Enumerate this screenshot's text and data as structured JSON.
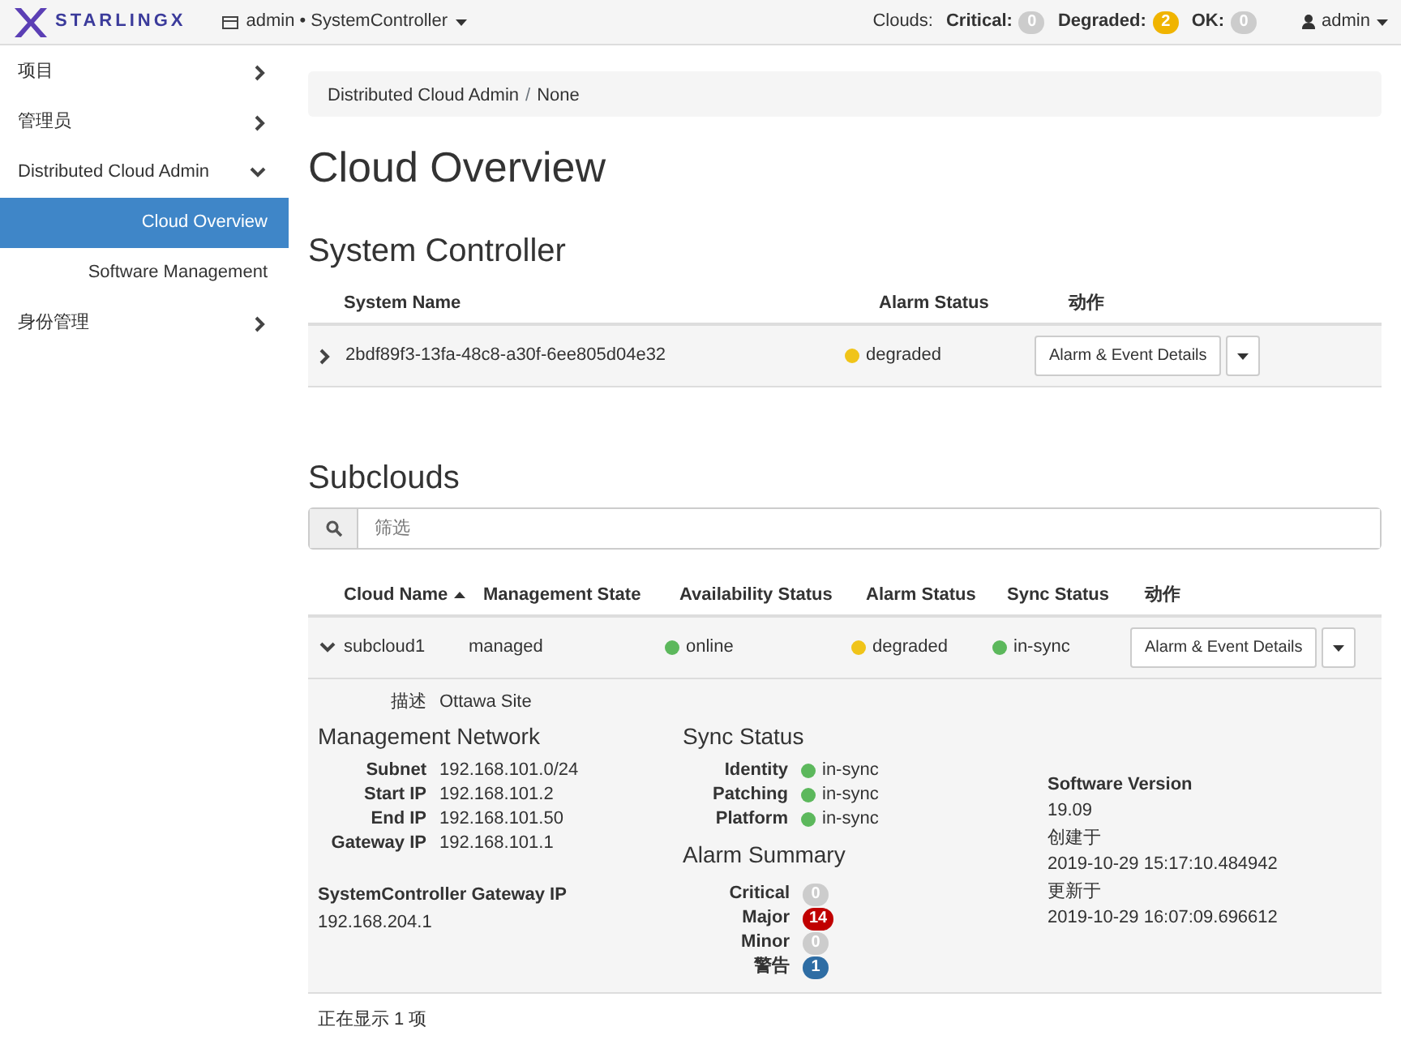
{
  "navbar": {
    "brand": "STARLINGX",
    "context": "admin • SystemController",
    "clouds_label": "Clouds:",
    "cloud_counts": [
      {
        "label": "Critical:",
        "count": "0",
        "color": "#cccccc"
      },
      {
        "label": "Degraded:",
        "count": "2",
        "color": "#f0b400"
      },
      {
        "label": "OK:",
        "count": "0",
        "color": "#cccccc"
      }
    ],
    "user": "admin"
  },
  "sidebar": {
    "items": [
      {
        "label": "项目",
        "expanded": false
      },
      {
        "label": "管理员",
        "expanded": false
      },
      {
        "label": "Distributed Cloud Admin",
        "expanded": true,
        "children": [
          {
            "label": "Cloud Overview",
            "selected": true
          },
          {
            "label": "Software Management",
            "selected": false
          }
        ]
      },
      {
        "label": "身份管理",
        "expanded": false
      }
    ]
  },
  "breadcrumb": {
    "items": [
      "Distributed Cloud Admin",
      "None"
    ],
    "separator": "/"
  },
  "title": "Cloud Overview",
  "system_controller": {
    "title": "System Controller",
    "columns": [
      "System Name",
      "Alarm Status",
      "动作"
    ],
    "rows": [
      {
        "expanded": false,
        "name": "2bdf89f3-13fa-48c8-a30f-6ee805d04e32",
        "alarm": {
          "text": "degraded",
          "color": "#f0c419"
        },
        "action": "Alarm & Event Details"
      }
    ]
  },
  "subclouds": {
    "title": "Subclouds",
    "filter_placeholder": "筛选",
    "columns": [
      {
        "label": "Cloud Name",
        "sorted": true
      },
      {
        "label": "Management State",
        "sorted": false
      },
      {
        "label": "Availability Status",
        "sorted": false
      },
      {
        "label": "Alarm Status",
        "sorted": false
      },
      {
        "label": "Sync Status",
        "sorted": false
      },
      {
        "label": "动作",
        "sorted": false
      }
    ],
    "rows": [
      {
        "expanded": true,
        "name": "subcloud1",
        "management": "managed",
        "availability": {
          "text": "online",
          "color": "#5cb85c"
        },
        "alarm": {
          "text": "degraded",
          "color": "#f0c419"
        },
        "sync": {
          "text": "in-sync",
          "color": "#5cb85c"
        },
        "action": "Alarm & Event Details",
        "detail": {
          "description_label": "描述",
          "description": "Ottawa Site",
          "network_title": "Management Network",
          "network": [
            {
              "label": "Subnet",
              "value": "192.168.101.0/24"
            },
            {
              "label": "Start IP",
              "value": "192.168.101.2"
            },
            {
              "label": "End IP",
              "value": "192.168.101.50"
            },
            {
              "label": "Gateway IP",
              "value": "192.168.101.1"
            }
          ],
          "sc_gateway_label": "SystemController Gateway IP",
          "sc_gateway": "192.168.204.1",
          "sync_title": "Sync Status",
          "sync": [
            {
              "label": "Identity",
              "text": "in-sync",
              "color": "#5cb85c"
            },
            {
              "label": "Patching",
              "text": "in-sync",
              "color": "#5cb85c"
            },
            {
              "label": "Platform",
              "text": "in-sync",
              "color": "#5cb85c"
            }
          ],
          "alarm_title": "Alarm Summary",
          "alarms": [
            {
              "label": "Critical",
              "count": "0",
              "color": "#cccccc"
            },
            {
              "label": "Major",
              "count": "14",
              "color": "#c00000"
            },
            {
              "label": "Minor",
              "count": "0",
              "color": "#cccccc"
            },
            {
              "label": "警告",
              "count": "1",
              "color": "#2e6da4"
            }
          ],
          "info": [
            {
              "label": "Software Version",
              "value": "19.09"
            },
            {
              "label": "创建于",
              "value": "2019-10-29 15:17:10.484942"
            },
            {
              "label": "更新于",
              "value": "2019-10-29 16:07:09.696612"
            }
          ]
        }
      }
    ],
    "footer": "正在显示 1 项"
  }
}
